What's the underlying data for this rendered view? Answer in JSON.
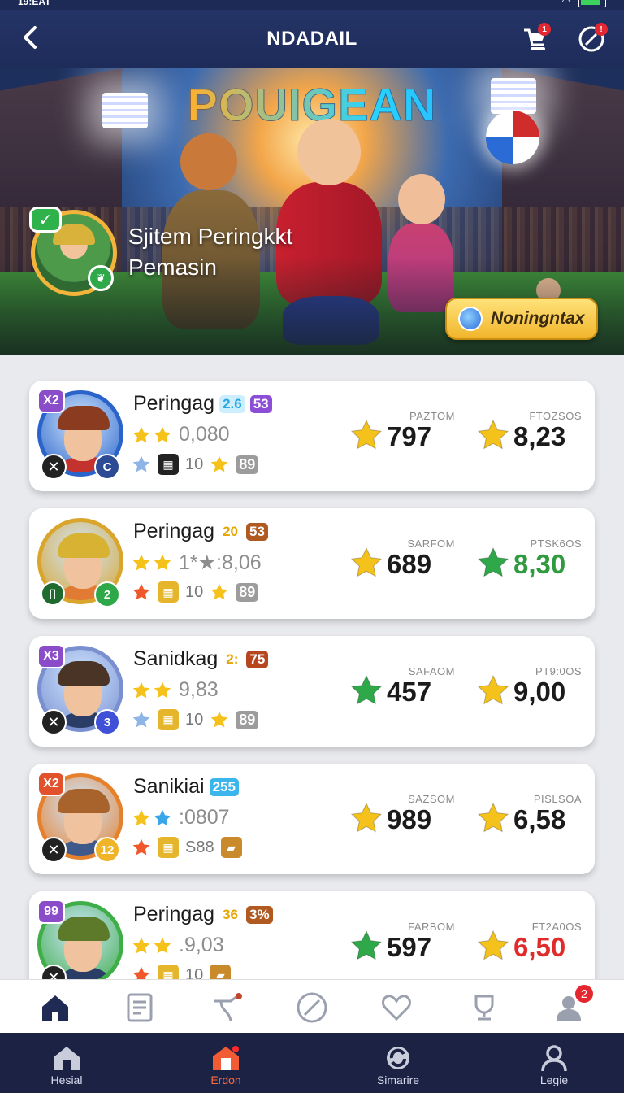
{
  "header": {
    "title": "NDADAIL",
    "cart_badge": "1",
    "edit_badge": "!"
  },
  "banner": {
    "logo": "POUIGEAN",
    "title_line1": "Sjitem Peringkkt",
    "title_line2": "Pemasin",
    "button_label": "Noningntax"
  },
  "players": [
    {
      "tag": "X2",
      "tag_color": "#8a4cc9",
      "name": "Peringag",
      "lvl1": "2.6",
      "lvl1_color": "#2aa7e0",
      "lvl1_bg": "#cdeffd",
      "lvl2": "53",
      "lvl2_color": "#fff",
      "lvl2_bg": "#8c4ed6",
      "score": "0,080",
      "stat_num": "10",
      "stat_box": "89",
      "br_badge": "C",
      "col1_label": "PAZTOM",
      "col1_value": "797",
      "col1_star": "#f5c21b",
      "col1_color": "#1b1b1b",
      "col2_label": "FTOZSOS",
      "col2_value": "8,23",
      "col2_star": "#f5c21b",
      "col2_color": "#1b1b1b",
      "ring": "#2a63c9",
      "hair": "#8b3b1f",
      "shirt": "#c4322f",
      "br_color": "#2d4a94"
    },
    {
      "tag": "",
      "tag_color": "#1f6b2f",
      "name": "Peringag",
      "lvl1": "20",
      "lvl1_color": "#e6a600",
      "lvl1_bg": "transparent",
      "lvl2": "53",
      "lvl2_color": "#fff",
      "lvl2_bg": "#b05a22",
      "score": "1*★:8,06",
      "stat_num": "10",
      "stat_box": "89",
      "br_badge": "2",
      "col1_label": "SARFOM",
      "col1_value": "689",
      "col1_star": "#f5c21b",
      "col1_color": "#1b1b1b",
      "col2_label": "PTSK6OS",
      "col2_value": "8,30",
      "col2_star": "#2fa84a",
      "col2_color": "#2f9a3e",
      "ring": "#d9a52c",
      "hair": "#d8b233",
      "shirt": "#e17b33",
      "br_color": "#2fa84a"
    },
    {
      "tag": "X3",
      "tag_color": "#8a4cc9",
      "name": "Sanidkag",
      "lvl1": "2:",
      "lvl1_color": "#e6a600",
      "lvl1_bg": "transparent",
      "lvl2": "75",
      "lvl2_color": "#fff",
      "lvl2_bg": "#b7461f",
      "score": "9,83",
      "stat_num": "10",
      "stat_box": "89",
      "br_badge": "3",
      "col1_label": "SAFAOM",
      "col1_value": "457",
      "col1_star": "#2fa84a",
      "col1_color": "#1b1b1b",
      "col2_label": "PT9:0OS",
      "col2_value": "9,00",
      "col2_star": "#f5c21b",
      "col2_color": "#1b1b1b",
      "ring": "#7a8fd0",
      "hair": "#4a3426",
      "shirt": "#2a3d66",
      "br_color": "#3f51d6"
    },
    {
      "tag": "X2",
      "tag_color": "#e0512c",
      "name": "Sanikiai",
      "lvl1": "255",
      "lvl1_color": "#fff",
      "lvl1_bg": "#3ab6ec",
      "lvl2": "",
      "lvl2_color": "#fff",
      "lvl2_bg": "transparent",
      "score": ":0807",
      "stat_num": "S88",
      "stat_box": "",
      "br_badge": "12",
      "col1_label": "SAZSOM",
      "col1_value": "989",
      "col1_star": "#f5c21b",
      "col1_color": "#1b1b1b",
      "col2_label": "PISLSOA",
      "col2_value": "6,58",
      "col2_star": "#f5c21b",
      "col2_color": "#1b1b1b",
      "ring": "#e5812c",
      "hair": "#a8632c",
      "shirt": "#3f5a8a",
      "br_color": "#f0b428"
    },
    {
      "tag": "99",
      "tag_color": "#8a4cc9",
      "name": "Peringag",
      "lvl1": "36",
      "lvl1_color": "#e6a600",
      "lvl1_bg": "transparent",
      "lvl2": "3%",
      "lvl2_color": "#fff",
      "lvl2_bg": "#b05a22",
      "score": ".9,03",
      "stat_num": "10",
      "stat_box": "",
      "br_badge": "",
      "col1_label": "FARBOM",
      "col1_value": "597",
      "col1_star": "#2fa84a",
      "col1_color": "#1b1b1b",
      "col2_label": "FT2A0OS",
      "col2_value": "6,50",
      "col2_star": "#f5c21b",
      "col2_color": "#e02b2b",
      "ring": "#3fae48",
      "hair": "#5c7a2a",
      "shirt": "#2a3d66",
      "br_color": "#2fa84a"
    }
  ],
  "iconbar": {
    "profile_badge": "2"
  },
  "nav": [
    {
      "label": "Hesial"
    },
    {
      "label": "Erdon"
    },
    {
      "label": "Simarire"
    },
    {
      "label": "Legie"
    }
  ]
}
